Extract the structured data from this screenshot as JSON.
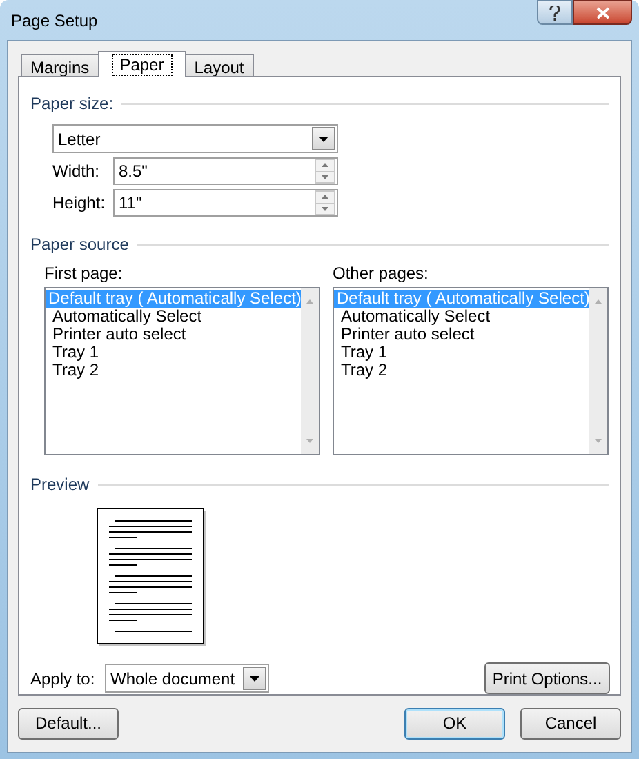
{
  "window": {
    "title": "Page Setup"
  },
  "tabs": [
    {
      "label": "Margins",
      "selected": false
    },
    {
      "label": "Paper",
      "selected": true
    },
    {
      "label": "Layout",
      "selected": false
    }
  ],
  "paper_size": {
    "label": "Paper size:",
    "value": "Letter",
    "width": {
      "label": "Width:",
      "value": "8.5\""
    },
    "height": {
      "label": "Height:",
      "value": "11\""
    }
  },
  "paper_source": {
    "label": "Paper source",
    "lists": [
      {
        "label": "First page:",
        "items": [
          {
            "text": "Default tray ( Automatically Select)",
            "selected": true
          },
          {
            "text": "Automatically Select",
            "selected": false
          },
          {
            "text": "Printer auto select",
            "selected": false
          },
          {
            "text": "Tray 1",
            "selected": false
          },
          {
            "text": "Tray 2",
            "selected": false
          }
        ]
      },
      {
        "label": "Other pages:",
        "items": [
          {
            "text": "Default tray ( Automatically Select)",
            "selected": true
          },
          {
            "text": "Automatically Select",
            "selected": false
          },
          {
            "text": "Printer auto select",
            "selected": false
          },
          {
            "text": "Tray 1",
            "selected": false
          },
          {
            "text": "Tray 2",
            "selected": false
          }
        ]
      }
    ]
  },
  "preview": {
    "label": "Preview"
  },
  "apply_to": {
    "label": "Apply to:",
    "value": "Whole document"
  },
  "print_options_button": "Print Options...",
  "buttons": [
    {
      "label": "Default...",
      "kind": "secondary"
    },
    {
      "label": "OK",
      "kind": "default"
    },
    {
      "label": "Cancel",
      "kind": "secondary"
    }
  ]
}
